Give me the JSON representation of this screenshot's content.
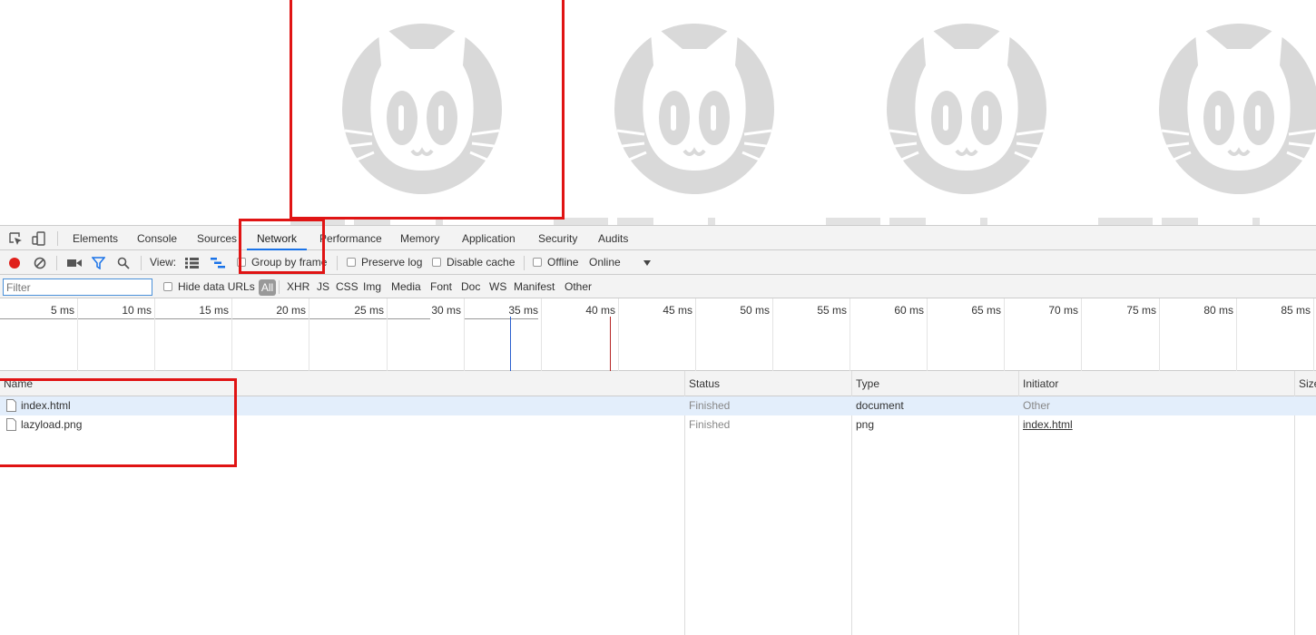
{
  "devtools": {
    "tabs": [
      "Elements",
      "Console",
      "Sources",
      "Network",
      "Performance",
      "Memory",
      "Application",
      "Security",
      "Audits"
    ],
    "active_tab": "Network",
    "toolbar": {
      "view_label": "View:",
      "group_by_frame": "Group by frame",
      "preserve_log": "Preserve log",
      "disable_cache": "Disable cache",
      "offline": "Offline",
      "throttling": "Online"
    },
    "filter": {
      "placeholder": "Filter",
      "hide_data_urls": "Hide data URLs",
      "all": "All",
      "types": [
        "XHR",
        "JS",
        "CSS",
        "Img",
        "Media",
        "Font",
        "Doc",
        "WS",
        "Manifest",
        "Other"
      ]
    },
    "overview": {
      "ticks": [
        "5 ms",
        "10 ms",
        "15 ms",
        "20 ms",
        "25 ms",
        "30 ms",
        "35 ms",
        "40 ms",
        "45 ms",
        "50 ms",
        "55 ms",
        "60 ms",
        "65 ms",
        "70 ms",
        "75 ms",
        "80 ms",
        "85 ms"
      ],
      "dom_content_loaded_ms": 33,
      "load_ms": 39.5,
      "colors": {
        "dom_content_loaded": "#2a5fce",
        "load": "#b52222"
      }
    },
    "columns": [
      "Name",
      "Status",
      "Type",
      "Initiator",
      "Size"
    ],
    "requests": [
      {
        "name": "index.html",
        "status": "Finished",
        "type": "document",
        "initiator": "Other"
      },
      {
        "name": "lazyload.png",
        "status": "Finished",
        "type": "png",
        "initiator": "index.html"
      }
    ]
  },
  "colors": {
    "accent": "#1a73e8",
    "highlight_box": "#e01414",
    "record": "#e0201b",
    "placeholder_image": "#d9d9d9"
  }
}
